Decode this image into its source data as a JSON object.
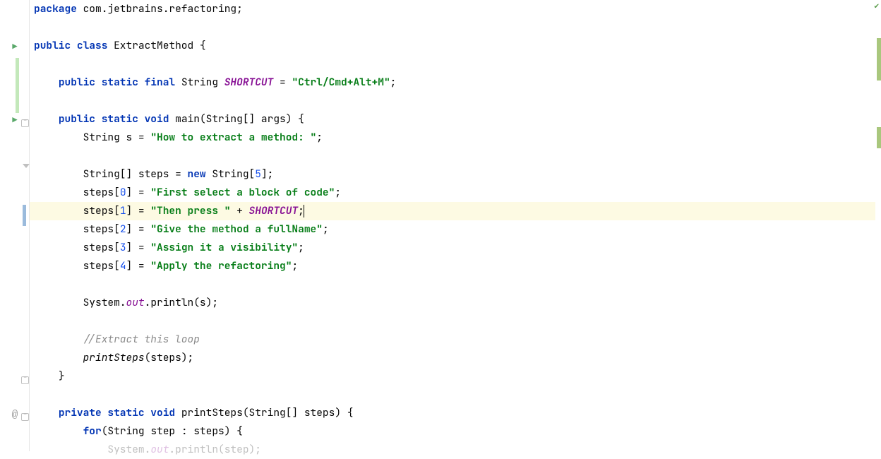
{
  "code": {
    "l1a": "package",
    "l1b": " com.jetbrains.refactoring;",
    "l3a": "public class",
    "l3b": " ExtractMethod {",
    "l5a": "public static final",
    "l5b": " String ",
    "l5c": "SHORTCUT",
    "l5d": " = ",
    "l5e": "\"Ctrl/Cmd+Alt+M\"",
    "l5f": ";",
    "l7a": "public static void",
    "l7b": " main(String[] args) {",
    "l8a": "String s = ",
    "l8b": "\"How to extract a method: \"",
    "l8c": ";",
    "l10a": "String[] steps = ",
    "l10b": "new",
    "l10c": " String[",
    "l10d": "5",
    "l10e": "];",
    "l11a": "steps[",
    "l11b": "0",
    "l11c": "] = ",
    "l11d": "\"First select a block of code\"",
    "l11e": ";",
    "l12a": "steps[",
    "l12b": "1",
    "l12c": "] = ",
    "l12d": "\"Then press \"",
    "l12e": " + ",
    "l12f": "SHORTCUT",
    "l12g": ";",
    "l13a": "steps[",
    "l13b": "2",
    "l13c": "] = ",
    "l13d": "\"Give the method a fullName\"",
    "l13e": ";",
    "l14a": "steps[",
    "l14b": "3",
    "l14c": "] = ",
    "l14d": "\"Assign it a visibility\"",
    "l14e": ";",
    "l15a": "steps[",
    "l15b": "4",
    "l15c": "] = ",
    "l15d": "\"Apply the refactoring\"",
    "l15e": ";",
    "l17a": "System.",
    "l17b": "out",
    "l17c": ".println(s);",
    "l19a": "//Extract this loop",
    "l20a": "printSteps",
    "l20b": "(steps);",
    "l21a": "}",
    "l23a": "private static void",
    "l23b": " printSteps(String[] steps) {",
    "l24a": "for",
    "l24b": "(String step : steps) {",
    "l25a": "System.",
    "l25b": "out",
    "l25c": ".println(step);"
  },
  "gutter": {
    "run1": "▶",
    "run2": "▶",
    "at": "@"
  }
}
